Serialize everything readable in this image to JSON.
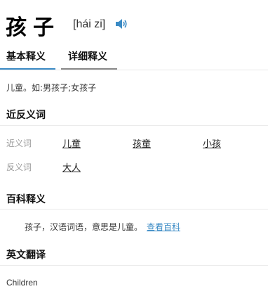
{
  "header": {
    "word": "孩子",
    "pinyin": "[hái zi]",
    "speaker_icon": "speaker-icon",
    "accent_color": "#3b8bc5"
  },
  "tabs": [
    {
      "label": "基本释义",
      "active": true
    },
    {
      "label": "详细释义",
      "active": false
    }
  ],
  "basic_definition": "儿童。如:男孩子;女孩子",
  "synonyms_antonyms": {
    "title": "近反义词",
    "synonym_label": "近义词",
    "synonyms": [
      "儿童",
      "孩童",
      "小孩"
    ],
    "antonym_label": "反义词",
    "antonyms": [
      "大人"
    ]
  },
  "baike": {
    "title": "百科释义",
    "text": "孩子，汉语词语，意思是儿童。",
    "link": "查看百科"
  },
  "english": {
    "title": "英文翻译",
    "text": "Children"
  }
}
